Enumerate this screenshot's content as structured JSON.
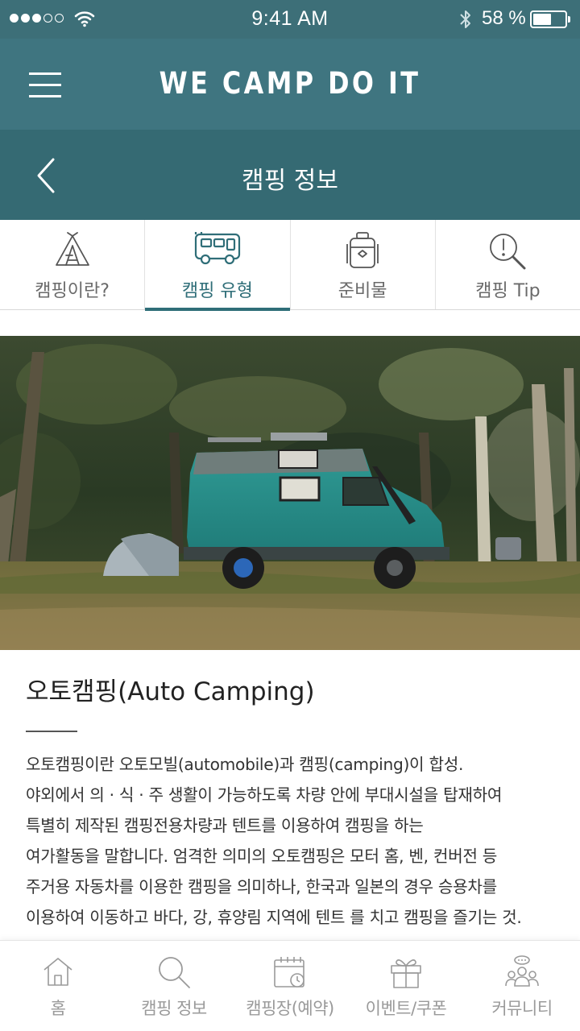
{
  "status_bar": {
    "time": "9:41 AM",
    "battery_percent_label": "58 %",
    "battery_level": 0.58,
    "signal_bars_filled": 3,
    "signal_bars_total": 5
  },
  "header": {
    "app_title": "WE CAMP DO IT",
    "menu_icon": "hamburger-icon"
  },
  "sub_header": {
    "title": "캠핑 정보",
    "back_icon": "chevron-left-icon"
  },
  "tabs": [
    {
      "label": "캠핑이란?",
      "icon": "tent-icon",
      "active": false
    },
    {
      "label": "캠핑 유형",
      "icon": "camper-van-icon",
      "active": true
    },
    {
      "label": "준비물",
      "icon": "backpack-icon",
      "active": false
    },
    {
      "label": "캠핑 Tip",
      "icon": "magnifier-alert-icon",
      "active": false
    }
  ],
  "article": {
    "title": "오토캠핑(Auto Camping)",
    "lines": [
      "오토캠핑이란 오토모빌(automobile)과 캠핑(camping)이 합성.",
      "야외에서 의 · 식 · 주 생활이 가능하도록 차량 안에 부대시설을 탑재하여",
      "특별히 제작된 캠핑전용차량과 텐트를 이용하여 캠핑을 하는",
      "여가활동을 말합니다. 엄격한 의미의 오토캠핑은 모터 홈, 벤, 컨버전 등",
      "주거용 자동차를 이용한 캠핑을 의미하나, 한국과 일본의 경우 승용차를",
      "이용하여 이동하고 바다, 강, 휴양림 지역에 텐트 를 치고 캠핑을 즐기는 것."
    ]
  },
  "bottom_nav": [
    {
      "label": "홈",
      "icon": "home-icon"
    },
    {
      "label": "캠핑 정보",
      "icon": "search-icon"
    },
    {
      "label": "캠핑장(예약)",
      "icon": "calendar-clock-icon"
    },
    {
      "label": "이벤트/쿠폰",
      "icon": "gift-icon"
    },
    {
      "label": "커뮤니티",
      "icon": "community-icon"
    }
  ],
  "colors": {
    "status_bar": "#3d6f78",
    "header": "#3f7580",
    "sub_header": "#356a73",
    "accent": "#2f6e78"
  }
}
